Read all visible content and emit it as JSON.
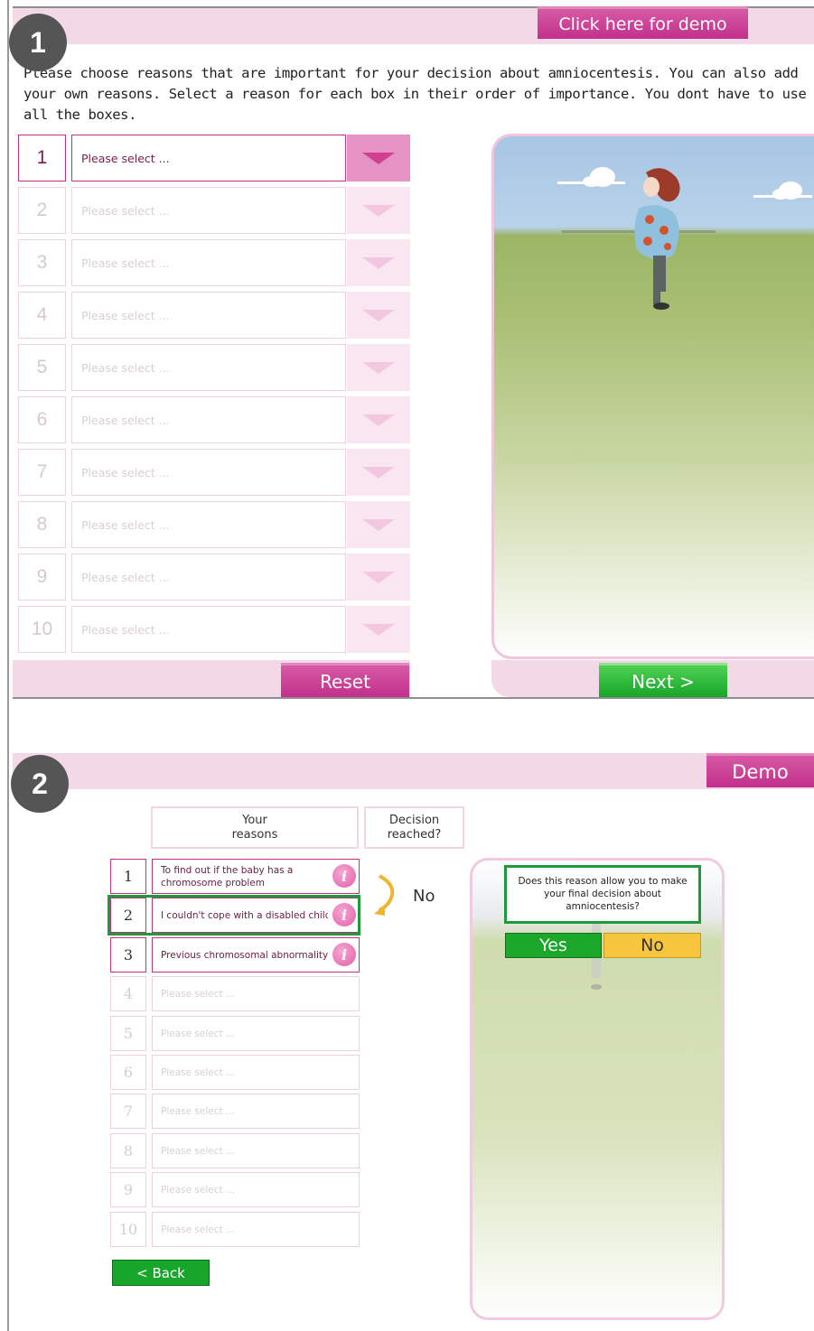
{
  "panel1": {
    "step": "1",
    "demo_label": "Click here for demo",
    "instructions": "Please choose reasons that are important for your decision about amniocentesis. You can also add your own reasons. Select a reason for each box in their order of importance. You dont have to use all the boxes.",
    "rows": [
      {
        "num": "1",
        "placeholder": "Please select ..."
      },
      {
        "num": "2",
        "placeholder": "Please select ..."
      },
      {
        "num": "3",
        "placeholder": "Please select ..."
      },
      {
        "num": "4",
        "placeholder": "Please select ..."
      },
      {
        "num": "5",
        "placeholder": "Please select ..."
      },
      {
        "num": "6",
        "placeholder": "Please select ..."
      },
      {
        "num": "7",
        "placeholder": "Please select ..."
      },
      {
        "num": "8",
        "placeholder": "Please select ..."
      },
      {
        "num": "9",
        "placeholder": "Please select ..."
      },
      {
        "num": "10",
        "placeholder": "Please select ..."
      }
    ],
    "reset_label": "Reset",
    "next_label": "Next >"
  },
  "panel2": {
    "step": "2",
    "demo_label": "Demo",
    "col_reasons": "Your reasons",
    "col_decision": "Decision reached?",
    "rows": [
      {
        "num": "1",
        "text": "To find out if the baby has a chromosome problem"
      },
      {
        "num": "2",
        "text": "I couldn't cope with a disabled child"
      },
      {
        "num": "3",
        "text": "Previous chromosomal abnormality"
      },
      {
        "num": "4",
        "text": "Please select ..."
      },
      {
        "num": "5",
        "text": "Please select ..."
      },
      {
        "num": "6",
        "text": "Please select ..."
      },
      {
        "num": "7",
        "text": "Please select ..."
      },
      {
        "num": "8",
        "text": "Please select ..."
      },
      {
        "num": "9",
        "text": "Please select ..."
      },
      {
        "num": "10",
        "text": "Please select ..."
      }
    ],
    "info_glyph": "i",
    "decision_value": "No",
    "question": "Does this reason allow you to make your final decision about amniocentesis?",
    "yes_label": "Yes",
    "no_label": "No",
    "back_label": "< Back"
  },
  "colors": {
    "accent_pink": "#c2308b",
    "header_pink": "#f3d9e8",
    "green": "#1aa72a",
    "yellow": "#f7c53e",
    "highlight_green": "#1e9a3b"
  }
}
